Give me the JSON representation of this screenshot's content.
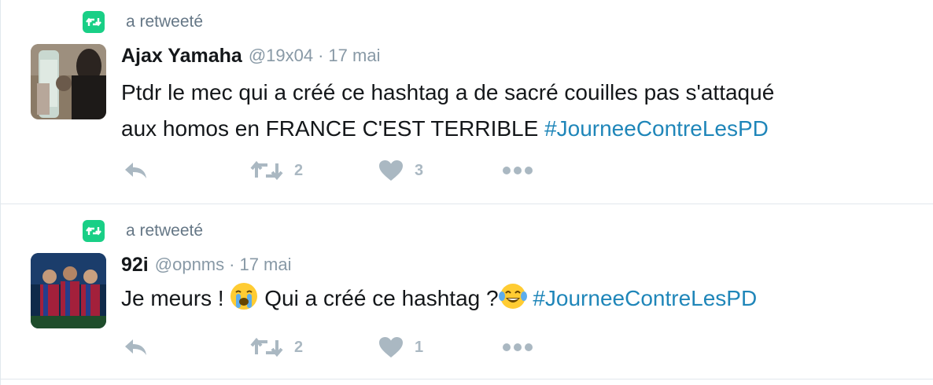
{
  "tweets": [
    {
      "retweet_label": "a retweeté",
      "fullname": "Ajax Yamaha",
      "username": "@19x04",
      "separator": "·",
      "time": "17 mai",
      "text_line1": "Ptdr le mec qui a créé ce hashtag a de sacré couilles pas s'attaqué",
      "text_line2": "aux homos en FRANCE C'EST TERRIBLE ",
      "hashtag": "#JourneeContreLesPD",
      "retweet_count": "2",
      "like_count": "3"
    },
    {
      "retweet_label": "a retweeté",
      "fullname": "92i",
      "username": "@opnms",
      "separator": "·",
      "time": "17 mai",
      "text_part1": "Je meurs ! ",
      "text_part2": " Qui a créé ce hashtag ?",
      "hashtag": "#JourneeContreLesPD",
      "retweet_count": "2",
      "like_count": "1"
    }
  ],
  "colors": {
    "retweet_badge": "#19cf86",
    "hashtag": "#1f86b9",
    "muted": "#8899a6",
    "action_icon": "#aab8c2"
  },
  "icons": [
    "retweet-badge-icon",
    "reply-icon",
    "retweet-icon",
    "heart-icon",
    "more-icon",
    "loudly-crying-face-emoji",
    "tears-of-joy-emoji"
  ]
}
